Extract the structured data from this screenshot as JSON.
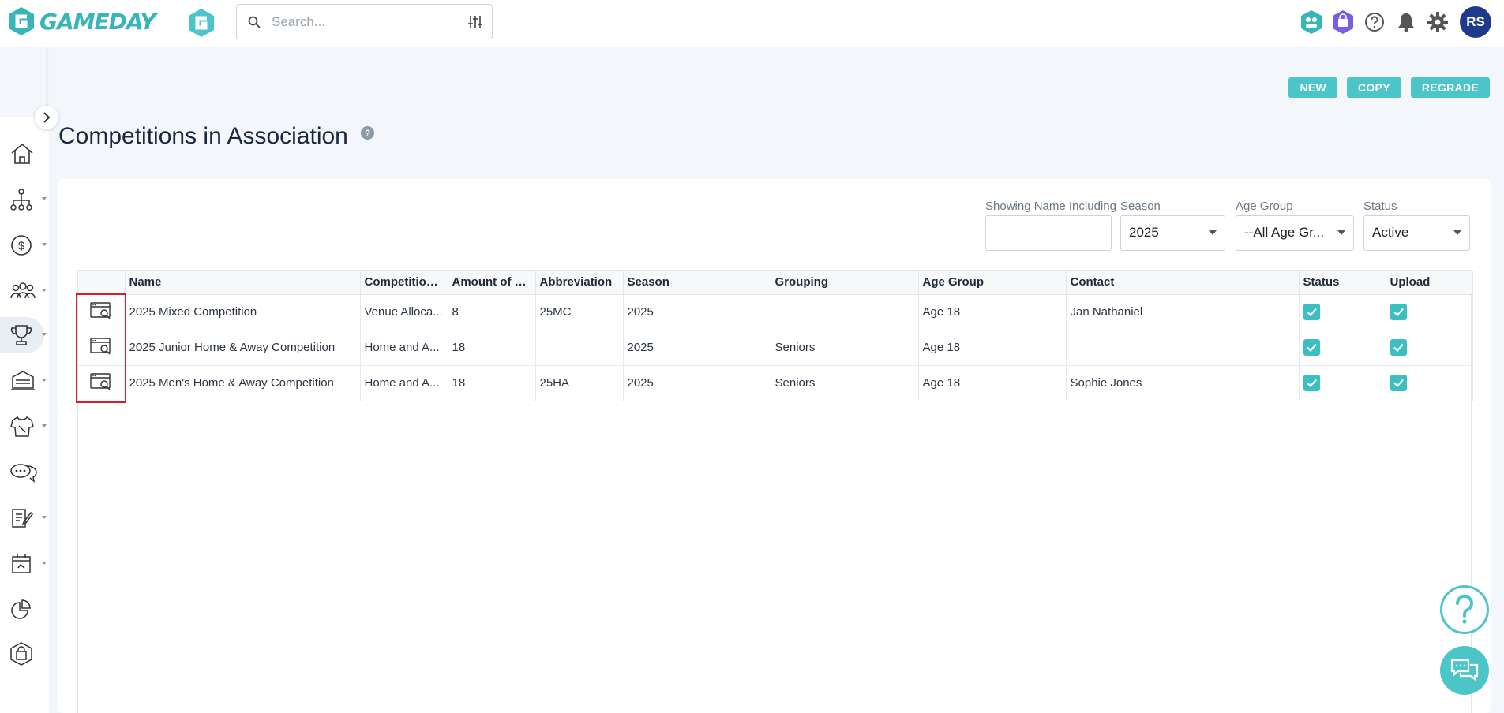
{
  "brand": {
    "name": "GAMEDAY",
    "accent": "#4cc5c9",
    "logo_color": "#37b5b8"
  },
  "search": {
    "placeholder": "Search..."
  },
  "header_icons": [
    "team-hub-icon",
    "shop-hex-icon",
    "help-circle-icon",
    "bell-icon",
    "gear-icon"
  ],
  "user": {
    "initials": "RS"
  },
  "sidebar": {
    "items": [
      {
        "icon": "home-icon",
        "caret": false
      },
      {
        "icon": "org-chart-icon",
        "caret": true
      },
      {
        "icon": "dollar-icon",
        "caret": true
      },
      {
        "icon": "people-icon",
        "caret": true
      },
      {
        "icon": "trophy-icon",
        "caret": true,
        "active": true
      },
      {
        "icon": "venue-icon",
        "caret": true
      },
      {
        "icon": "jersey-icon",
        "caret": true
      },
      {
        "icon": "chat-bubbles-icon",
        "caret": false
      },
      {
        "icon": "edit-doc-icon",
        "caret": true
      },
      {
        "icon": "calendar-icon",
        "caret": true
      },
      {
        "icon": "pie-chart-icon",
        "caret": false
      },
      {
        "icon": "bag-icon",
        "caret": false
      }
    ]
  },
  "actions": {
    "new": "NEW",
    "copy": "COPY",
    "regrade": "REGRADE"
  },
  "page": {
    "title": "Competitions in Association",
    "help": "?"
  },
  "filters": {
    "name": {
      "label": "Showing Name Including",
      "value": ""
    },
    "season": {
      "label": "Season",
      "value": "2025"
    },
    "age_group": {
      "label": "Age Group",
      "value": "--All Age Gr..."
    },
    "status": {
      "label": "Status",
      "value": "Active"
    }
  },
  "table": {
    "columns": [
      "",
      "Name",
      "Competition ...",
      "Amount of Te...",
      "Abbreviation",
      "Season",
      "Grouping",
      "Age Group",
      "Contact",
      "Status",
      "Upload"
    ],
    "rows": [
      {
        "name": "2025 Mixed Competition",
        "type": "Venue Alloca...",
        "teams": "8",
        "abbr": "25MC",
        "season": "2025",
        "grouping": "",
        "age": "Age 18",
        "contact": "Jan Nathaniel",
        "status": true,
        "upload": true
      },
      {
        "name": "2025 Junior Home & Away Competition",
        "type": "Home and A...",
        "teams": "18",
        "abbr": "",
        "season": "2025",
        "grouping": "Seniors",
        "age": "Age 18",
        "contact": "",
        "status": true,
        "upload": true
      },
      {
        "name": "2025 Men's Home & Away Competition",
        "type": "Home and A...",
        "teams": "18",
        "abbr": "25HA",
        "season": "2025",
        "grouping": "Seniors",
        "age": "Age 18",
        "contact": "Sophie Jones",
        "status": true,
        "upload": true
      }
    ]
  }
}
